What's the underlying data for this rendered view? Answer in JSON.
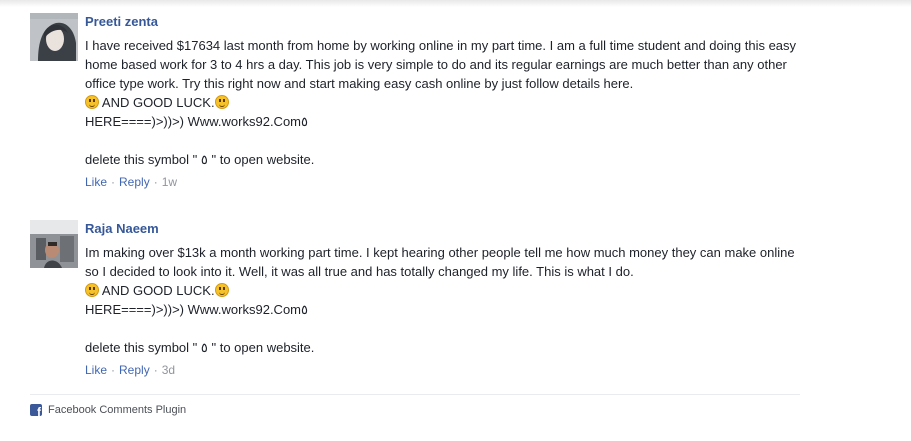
{
  "comments": [
    {
      "author": "Preeti zenta",
      "paragraph": "I have received $17634 last month from home by working online in my part time. I am a full time student and doing this easy home based work for 3 to 4 hrs a day. This job is very simple to do and its regular earnings are much better than any other office type work. Try this right now and start making easy cash online by just follow details here.",
      "luck": " AND GOOD LUCK.",
      "here_line": "HERE====)>))>) Www.works92.Com٥",
      "delete_line": "delete this symbol \" ٥ \" to open website.",
      "like": "Like",
      "reply": "Reply",
      "dot": "·",
      "time": "1w"
    },
    {
      "author": "Raja Naeem",
      "paragraph": "Im making over $13k a month working part time. I kept hearing other people tell me how much money they can make online so I decided to look into it. Well, it was all true and has totally changed my life. This is what I do.",
      "luck": " AND GOOD LUCK.",
      "here_line": "HERE====)>))>) Www.works92.Com٥",
      "delete_line": "delete this symbol \" ٥ \" to open website.",
      "like": "Like",
      "reply": "Reply",
      "dot": "·",
      "time": "3d"
    }
  ],
  "footer": {
    "icon": "facebook-icon",
    "label": "Facebook Comments Plugin"
  },
  "colors": {
    "author": "#365899",
    "link": "#4267b2",
    "meta": "#90949c",
    "text": "#1d2129",
    "fb_brand": "#3b5998"
  }
}
